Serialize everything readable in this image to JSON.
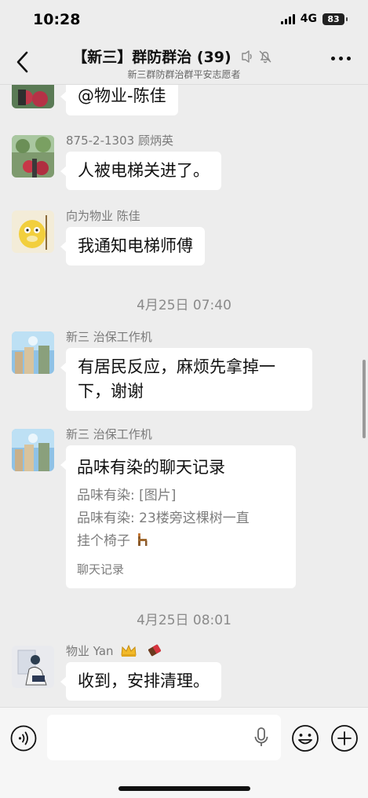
{
  "status": {
    "time": "10:28",
    "network": "4G",
    "battery": "83"
  },
  "header": {
    "title": "【新三】群防群治 (39)",
    "subtitle": "新三群防群治群平安志愿者"
  },
  "messages": [
    {
      "sender": "",
      "text": "@物业-陈佳"
    },
    {
      "sender": "875-2-1303 顾炳英",
      "text": "人被电梯关进了。"
    },
    {
      "sender": "向为物业 陈佳",
      "text": "我通知电梯师傅"
    },
    {
      "timestamp": "4月25日 07:40"
    },
    {
      "sender": "新三 治保工作机",
      "text_lines": [
        "有居民反应，麻烦先拿掉一",
        "下，谢谢"
      ]
    },
    {
      "sender": "新三 治保工作机",
      "record": {
        "title": "品味有染的聊天记录",
        "lines": [
          "品味有染: [图片]",
          "品味有染: 23楼旁这棵树一直",
          "挂个椅子"
        ],
        "footer": "聊天记录"
      }
    },
    {
      "timestamp": "4月25日 08:01"
    },
    {
      "sender": "物业 Yan",
      "text": "收到，安排清理。"
    }
  ],
  "icons": {
    "back": "chevron-left-icon",
    "more": "more-icon",
    "voice": "voice-icon",
    "mic": "mic-icon",
    "emoji": "emoji-icon",
    "plus": "plus-icon"
  }
}
